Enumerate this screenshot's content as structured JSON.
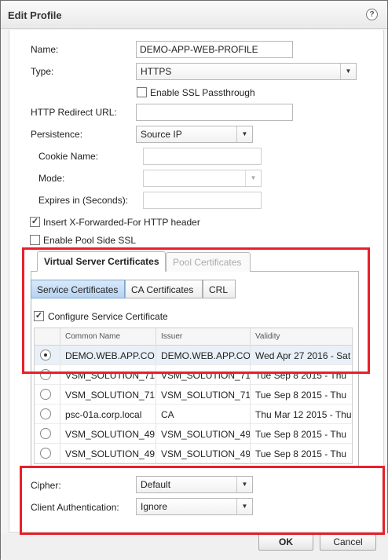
{
  "dialog": {
    "title": "Edit Profile",
    "help_glyph": "?"
  },
  "form": {
    "name_label": "Name:",
    "name_value": "DEMO-APP-WEB-PROFILE",
    "type_label": "Type:",
    "type_value": "HTTPS",
    "ssl_passthrough_label": "Enable SSL Passthrough",
    "ssl_passthrough_checked": false,
    "redirect_label": "HTTP Redirect URL:",
    "redirect_value": "",
    "persistence_label": "Persistence:",
    "persistence_value": "Source IP",
    "cookie_label": "Cookie Name:",
    "cookie_value": "",
    "mode_label": "Mode:",
    "mode_value": "",
    "expires_label": "Expires in (Seconds):",
    "expires_value": "",
    "xff_label": "Insert X-Forwarded-For HTTP header",
    "xff_checked": true,
    "pool_ssl_label": "Enable Pool Side SSL",
    "pool_ssl_checked": false
  },
  "tabs": {
    "items": [
      {
        "label": "Virtual Server Certificates",
        "active": true
      },
      {
        "label": "Pool Certificates",
        "active": false
      }
    ]
  },
  "segments": {
    "items": [
      {
        "label": "Service Certificates",
        "active": true
      },
      {
        "label": "CA Certificates",
        "active": false
      },
      {
        "label": "CRL",
        "active": false
      }
    ]
  },
  "configure_cert": {
    "label": "Configure Service Certificate",
    "checked": true
  },
  "cert_table": {
    "columns": [
      "Common Name",
      "Issuer",
      "Validity"
    ],
    "rows": [
      {
        "common_name": "DEMO.WEB.APP.CO",
        "issuer": "DEMO.WEB.APP.CO",
        "validity": "Wed Apr 27 2016 - Sat",
        "selected": true
      },
      {
        "common_name": "VSM_SOLUTION_71",
        "issuer": "VSM_SOLUTION_71",
        "validity": "Tue Sep 8 2015 - Thu",
        "selected": false
      },
      {
        "common_name": "VSM_SOLUTION_71",
        "issuer": "VSM_SOLUTION_71",
        "validity": "Tue Sep 8 2015 - Thu",
        "selected": false
      },
      {
        "common_name": "psc-01a.corp.local",
        "issuer": "CA",
        "validity": "Thu Mar 12 2015 - Thu",
        "selected": false
      },
      {
        "common_name": "VSM_SOLUTION_49",
        "issuer": "VSM_SOLUTION_49",
        "validity": "Tue Sep 8 2015 - Thu",
        "selected": false
      },
      {
        "common_name": "VSM_SOLUTION_49",
        "issuer": "VSM_SOLUTION_49",
        "validity": "Tue Sep 8 2015 - Thu",
        "selected": false
      }
    ]
  },
  "cipher": {
    "label": "Cipher:",
    "value": "Default"
  },
  "client_auth": {
    "label": "Client Authentication:",
    "value": "Ignore"
  },
  "footer": {
    "ok_label": "OK",
    "cancel_label": "Cancel"
  },
  "colors": {
    "highlight": "#e8202a",
    "active_segment": "#b7d3f1"
  }
}
